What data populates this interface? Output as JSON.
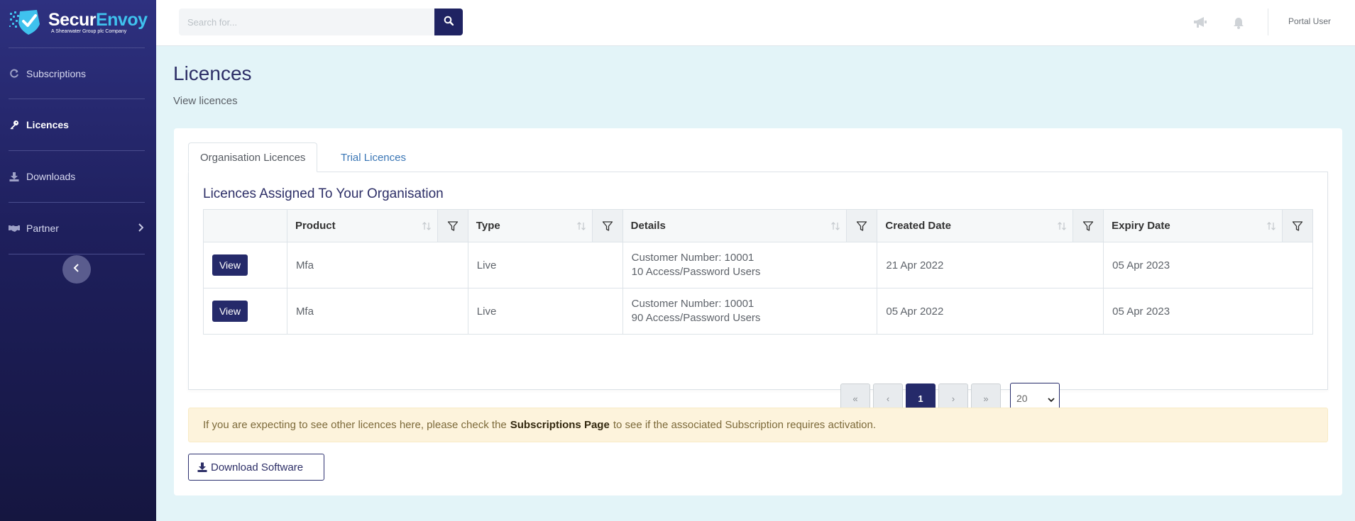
{
  "brand": {
    "name_part1": "Secur",
    "name_part2": "Envoy",
    "tagline": "A Shearwater Group plc Company"
  },
  "sidebar": {
    "items": [
      {
        "label": "Subscriptions",
        "icon": "refresh-icon"
      },
      {
        "label": "Licences",
        "icon": "key-icon",
        "active": true
      },
      {
        "label": "Downloads",
        "icon": "download-icon"
      },
      {
        "label": "Partner",
        "icon": "handshake-icon",
        "has_submenu": true
      }
    ],
    "collapse_icon": "chevron-left-icon"
  },
  "topbar": {
    "search_placeholder": "Search for...",
    "search_icon": "search-icon",
    "icons": [
      "megaphone-icon",
      "bell-icon"
    ],
    "user_label": "Portal User"
  },
  "page": {
    "title": "Licences",
    "subtitle": "View licences"
  },
  "tabs": [
    {
      "label": "Organisation Licences",
      "active": true
    },
    {
      "label": "Trial Licences",
      "active": false
    }
  ],
  "panel": {
    "title": "Licences Assigned To Your Organisation"
  },
  "table": {
    "columns": [
      "Product",
      "Type",
      "Details",
      "Created Date",
      "Expiry Date"
    ],
    "rows": [
      {
        "action": "View",
        "product": "Mfa",
        "type": "Live",
        "details_line1": "Customer Number: 10001",
        "details_line2": "10 Access/Password Users",
        "created": "21 Apr 2022",
        "expiry": "05 Apr 2023"
      },
      {
        "action": "View",
        "product": "Mfa",
        "type": "Live",
        "details_line1": "Customer Number: 10001",
        "details_line2": "90 Access/Password Users",
        "created": "05 Apr 2022",
        "expiry": "05 Apr 2023"
      }
    ]
  },
  "pagination": {
    "first": "«",
    "prev": "‹",
    "current": "1",
    "next": "›",
    "last": "»",
    "page_size": "20"
  },
  "alert": {
    "text_before": "If you are expecting to see other licences here, please check the",
    "link": "Subscriptions Page",
    "text_after": "to see if the associated Subscription requires activation."
  },
  "download_button": {
    "label": "Download Software"
  },
  "colors": {
    "sidebar_top": "#2e3180",
    "sidebar_bottom": "#151640",
    "primary": "#252a6a",
    "accent": "#3fc2ee",
    "page_bg": "#e3f4f8",
    "alert_bg": "#fdf3dc"
  }
}
